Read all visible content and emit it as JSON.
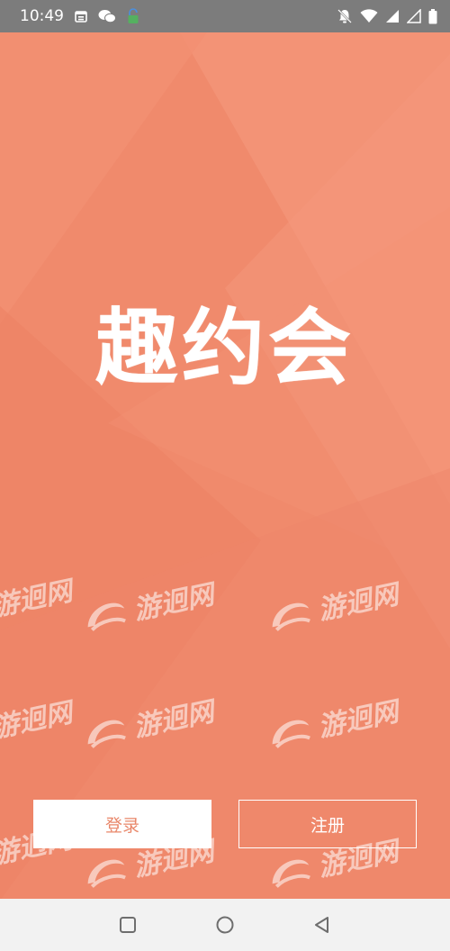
{
  "status_bar": {
    "time": "10:49",
    "left_icons": [
      "calendar-icon",
      "wechat-icon",
      "lock-app-icon"
    ],
    "right_icons": [
      "bell-muted-icon",
      "wifi-icon",
      "signal-icon",
      "signal-empty-icon",
      "battery-icon"
    ]
  },
  "app": {
    "title": "趣约会"
  },
  "watermark": {
    "text": "游迥网"
  },
  "actions": {
    "login_label": "登录",
    "register_label": "注册"
  },
  "nav_bar": {
    "icons": [
      "square-recents-icon",
      "circle-home-icon",
      "triangle-back-icon"
    ]
  },
  "colors": {
    "background": "#F08A6C",
    "status_bar": "#7C7C7C",
    "login_text": "#E9876A",
    "nav_bar": "#F2F2F2"
  }
}
